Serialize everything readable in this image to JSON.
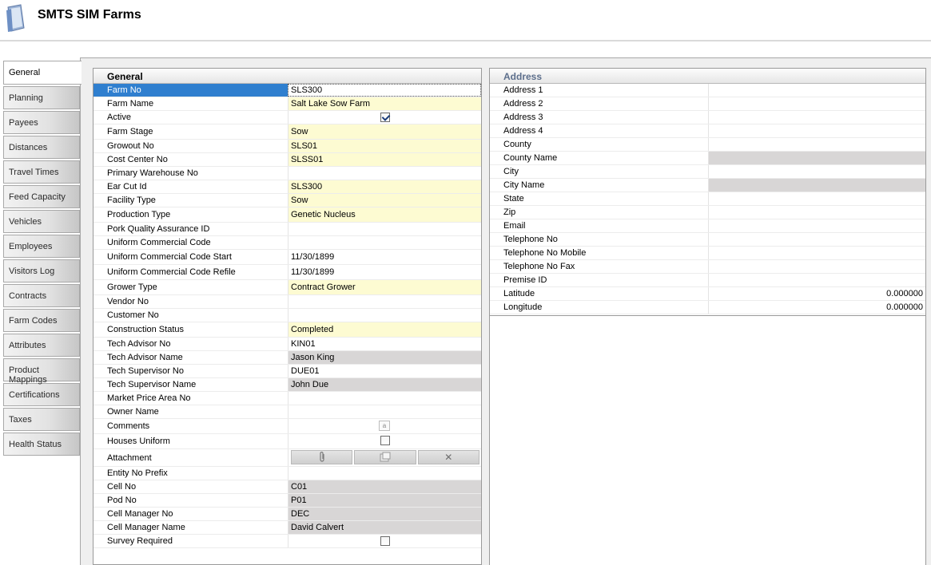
{
  "app": {
    "title": "SMTS SIM Farms",
    "icon": "document-icon"
  },
  "tabs": [
    {
      "label": "General",
      "active": true
    },
    {
      "label": "Planning"
    },
    {
      "label": "Payees"
    },
    {
      "label": "Distances"
    },
    {
      "label": "Travel Times"
    },
    {
      "label": "Feed Capacity"
    },
    {
      "label": "Vehicles"
    },
    {
      "label": "Employees"
    },
    {
      "label": "Visitors Log"
    },
    {
      "label": "Contracts"
    },
    {
      "label": "Farm Codes"
    },
    {
      "label": "Attributes"
    },
    {
      "label": "Product Mappings"
    },
    {
      "label": "Certifications"
    },
    {
      "label": "Taxes"
    },
    {
      "label": "Health Status"
    }
  ],
  "general": {
    "header": "General",
    "rows": [
      {
        "label": "Farm No",
        "value": "SLS300"
      },
      {
        "label": "Farm Name",
        "value": "Salt Lake Sow Farm"
      },
      {
        "label": "Active",
        "value": "",
        "checked": true
      },
      {
        "label": "Farm Stage",
        "value": "Sow"
      },
      {
        "label": "Growout No",
        "value": "SLS01"
      },
      {
        "label": "Cost Center No",
        "value": "SLSS01"
      },
      {
        "label": "Primary Warehouse No",
        "value": ""
      },
      {
        "label": "Ear Cut Id",
        "value": "SLS300"
      },
      {
        "label": "Facility Type",
        "value": "Sow"
      },
      {
        "label": "Production Type",
        "value": "Genetic Nucleus"
      },
      {
        "label": "Pork Quality Assurance ID",
        "value": ""
      },
      {
        "label": "Uniform Commercial Code",
        "value": ""
      },
      {
        "label": "Uniform Commercial Code Start",
        "value": "11/30/1899"
      },
      {
        "label": "Uniform Commercial Code Refile",
        "value": "11/30/1899"
      },
      {
        "label": "Grower Type",
        "value": "Contract Grower"
      },
      {
        "label": "Vendor No",
        "value": ""
      },
      {
        "label": "Customer No",
        "value": ""
      },
      {
        "label": "Construction Status",
        "value": "Completed"
      },
      {
        "label": "Tech Advisor No",
        "value": "KIN01"
      },
      {
        "label": "Tech Advisor Name",
        "value": "Jason King"
      },
      {
        "label": "Tech Supervisor No",
        "value": "DUE01"
      },
      {
        "label": "Tech Supervisor Name",
        "value": "John Due"
      },
      {
        "label": "Market Price Area No",
        "value": ""
      },
      {
        "label": "Owner Name",
        "value": ""
      },
      {
        "label": "Comments",
        "value": ""
      },
      {
        "label": "Houses Uniform",
        "value": "",
        "checked": false
      },
      {
        "label": "Attachment",
        "value": ""
      },
      {
        "label": "Entity No Prefix",
        "value": ""
      },
      {
        "label": "Cell No",
        "value": "C01"
      },
      {
        "label": "Pod No",
        "value": "P01"
      },
      {
        "label": "Cell Manager No",
        "value": "DEC"
      },
      {
        "label": "Cell Manager Name",
        "value": "David Calvert"
      },
      {
        "label": "Survey Required",
        "value": "",
        "checked": false
      }
    ]
  },
  "address": {
    "header": "Address",
    "rows": [
      {
        "label": "Address 1",
        "value": ""
      },
      {
        "label": "Address 2",
        "value": ""
      },
      {
        "label": "Address 3",
        "value": ""
      },
      {
        "label": "Address 4",
        "value": ""
      },
      {
        "label": "County",
        "value": ""
      },
      {
        "label": "County Name",
        "value": ""
      },
      {
        "label": "City",
        "value": ""
      },
      {
        "label": "City Name",
        "value": ""
      },
      {
        "label": "State",
        "value": ""
      },
      {
        "label": "Zip",
        "value": ""
      },
      {
        "label": "Email",
        "value": ""
      },
      {
        "label": "Telephone No",
        "value": ""
      },
      {
        "label": "Telephone No Mobile",
        "value": ""
      },
      {
        "label": "Telephone No Fax",
        "value": ""
      },
      {
        "label": "Premise ID",
        "value": ""
      },
      {
        "label": "Latitude",
        "value": "0.000000"
      },
      {
        "label": "Longitude",
        "value": "0.000000"
      }
    ]
  },
  "icons": {
    "comment": "comment-icon",
    "attach": "paperclip-icon",
    "open": "open-file-icon",
    "delete": "delete-icon"
  }
}
